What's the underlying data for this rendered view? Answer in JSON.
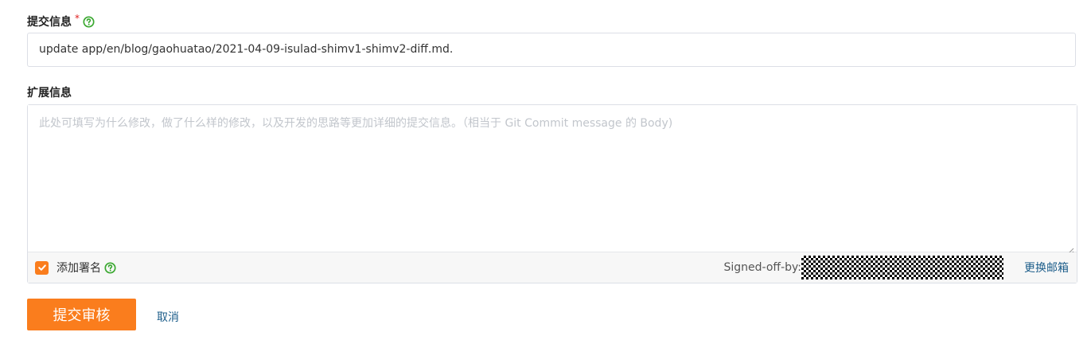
{
  "commit_message": {
    "label": "提交信息",
    "required_mark": "*",
    "help_icon": "question-circle-icon",
    "value": "update app/en/blog/gaohuatao/2021-04-09-isulad-shimv1-shimv2-diff.md."
  },
  "extended_info": {
    "label": "扩展信息",
    "placeholder": "此处可填写为什么修改，做了什么样的修改，以及开发的思路等更加详细的提交信息。（相当于 Git Commit message 的 Body)",
    "value": ""
  },
  "signature": {
    "checkbox_checked": true,
    "label": "添加署名",
    "help_icon": "question-circle-icon",
    "signed_off_prefix": "Signed-off-by:",
    "change_email_label": "更换邮箱"
  },
  "actions": {
    "submit_label": "提交审核",
    "cancel_label": "取消"
  },
  "colors": {
    "accent": "#fa7d1d",
    "help_icon": "#3aa830",
    "link": "#1c5d8a",
    "required": "#e02020"
  }
}
